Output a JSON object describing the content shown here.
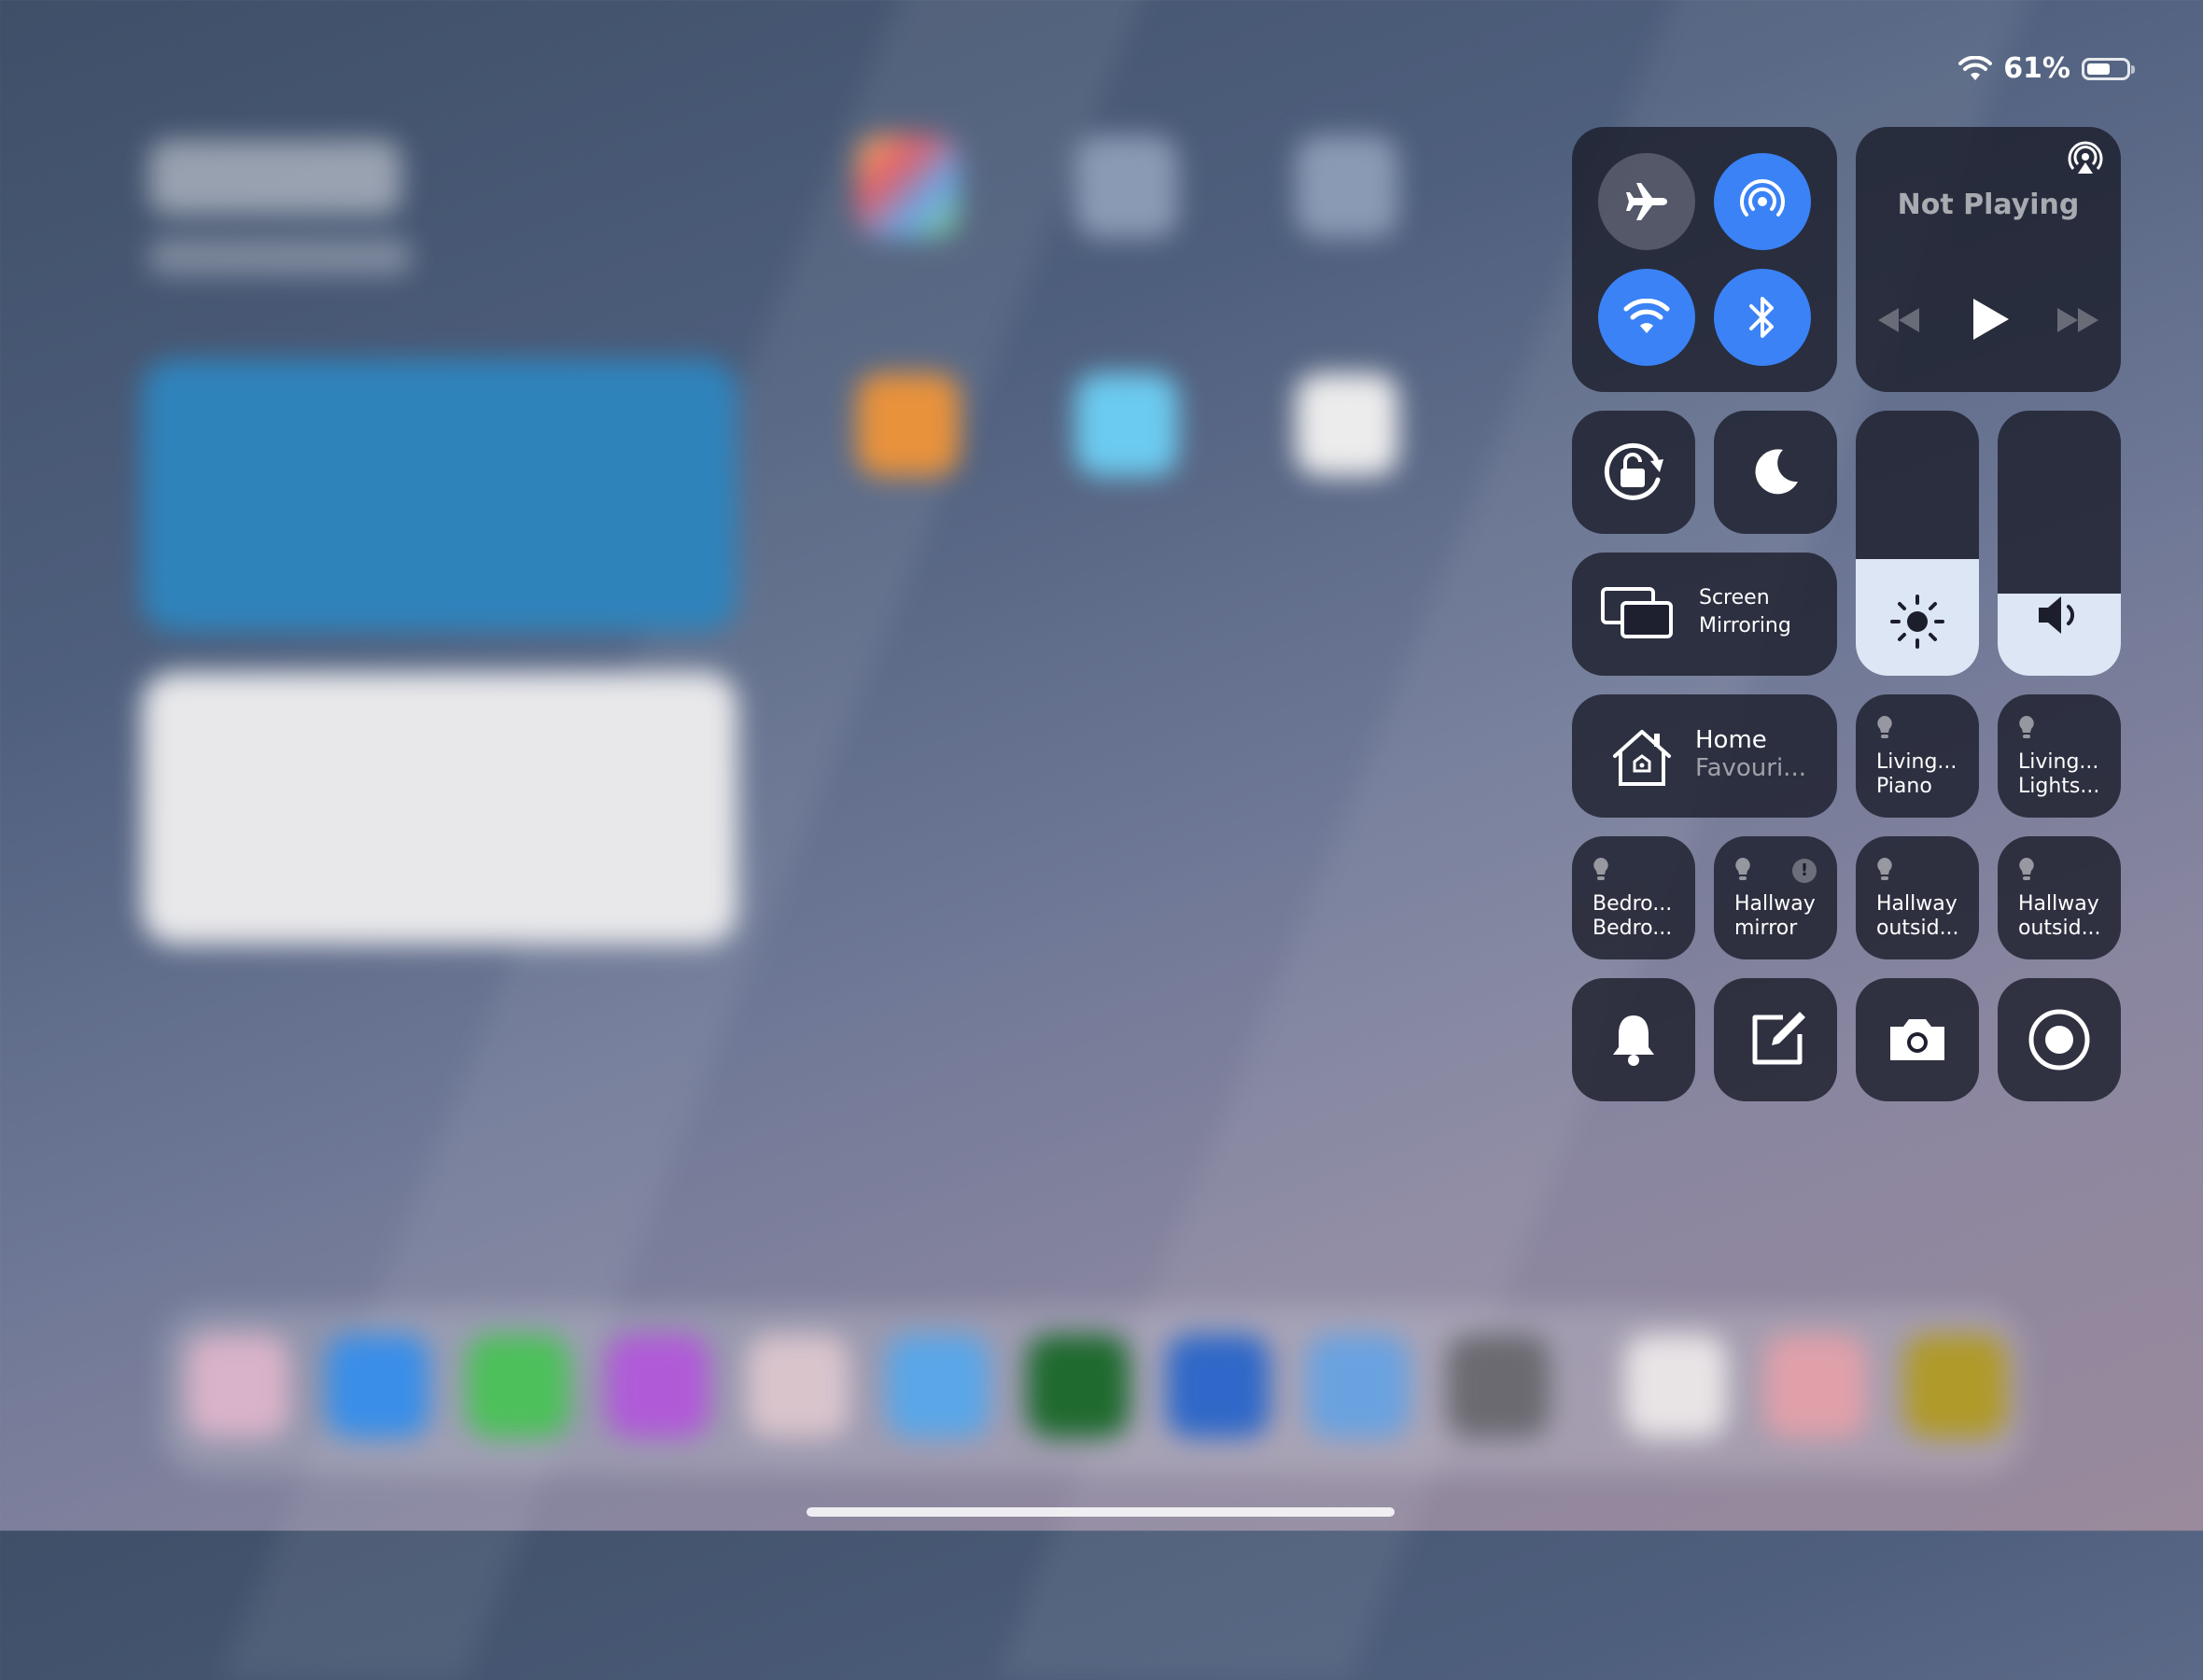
{
  "status_bar": {
    "battery_percent": "61%",
    "battery_level": 0.61,
    "wifi_icon": "wifi-icon"
  },
  "connectivity": {
    "airplane_mode": {
      "icon": "airplane-icon",
      "state": "off"
    },
    "airdrop": {
      "icon": "airdrop-icon",
      "state": "on"
    },
    "wifi": {
      "icon": "wifi-icon",
      "state": "on"
    },
    "bluetooth": {
      "icon": "bluetooth-icon",
      "state": "on"
    }
  },
  "media": {
    "title": "Not Playing",
    "airplay_icon": "airplay-icon"
  },
  "screen_mirroring": {
    "line1": "Screen",
    "line2": "Mirroring"
  },
  "brightness": {
    "level": 0.44
  },
  "volume": {
    "level": 0.31
  },
  "home": {
    "title": "Home",
    "subtitle": "Favouri..."
  },
  "accessories": [
    {
      "line1": "Living...",
      "line2": "Piano"
    },
    {
      "line1": "Living...",
      "line2": "Lights..."
    },
    {
      "line1": "Bedro...",
      "line2": "Bedro..."
    },
    {
      "line1": "Hallway",
      "line2": "mirror",
      "alert": "!"
    },
    {
      "line1": "Hallway",
      "line2": "outsid..."
    },
    {
      "line1": "Hallway",
      "line2": "outsid..."
    }
  ],
  "accent_color": "#3a82f6"
}
